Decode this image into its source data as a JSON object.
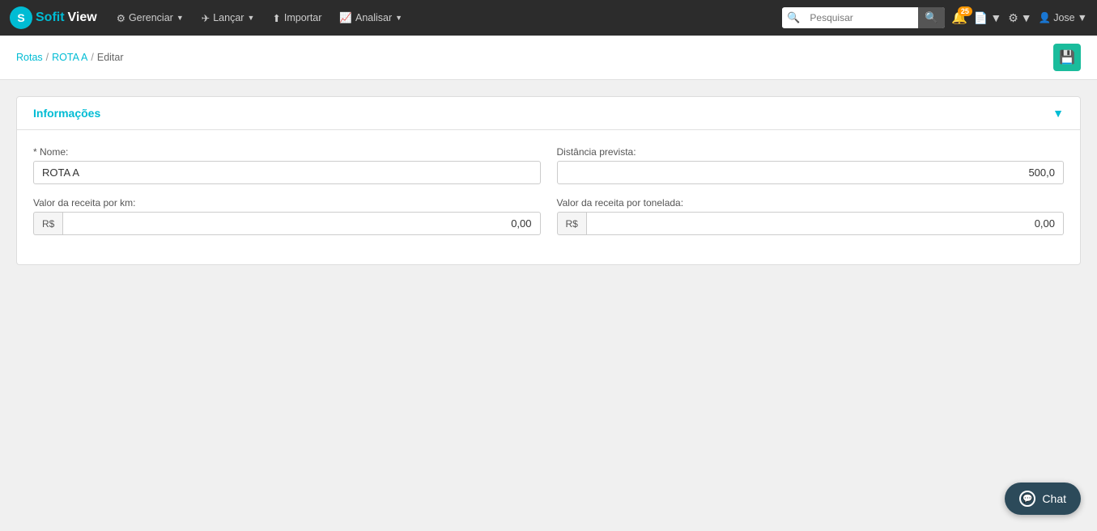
{
  "brand": {
    "sofit": "Sofit",
    "view": "View"
  },
  "navbar": {
    "items": [
      {
        "id": "gerenciar",
        "label": "Gerenciar",
        "icon": "⚙",
        "hasDropdown": true
      },
      {
        "id": "lancar",
        "label": "Lançar",
        "icon": "✈",
        "hasDropdown": true
      },
      {
        "id": "importar",
        "label": "Importar",
        "icon": "⬆",
        "hasDropdown": false
      },
      {
        "id": "analisar",
        "label": "Analisar",
        "icon": "📈",
        "hasDropdown": true
      }
    ],
    "search": {
      "placeholder": "Pesquisar"
    },
    "notifications": {
      "badge": "25"
    },
    "user": {
      "name": "Jose"
    }
  },
  "breadcrumb": {
    "items": [
      {
        "label": "Rotas",
        "link": true
      },
      {
        "label": "ROTA A",
        "link": true
      },
      {
        "label": "Editar",
        "link": false
      }
    ]
  },
  "form": {
    "section_title": "Informações",
    "fields": {
      "nome_label": "* Nome:",
      "nome_value": "ROTA A",
      "distancia_label": "Distância prevista:",
      "distancia_value": "500,0",
      "receita_km_label": "Valor da receita por km:",
      "receita_km_prefix": "R$",
      "receita_km_value": "0,00",
      "receita_ton_label": "Valor da receita por tonelada:",
      "receita_ton_prefix": "R$",
      "receita_ton_value": "0,00"
    }
  },
  "chat": {
    "label": "Chat"
  }
}
